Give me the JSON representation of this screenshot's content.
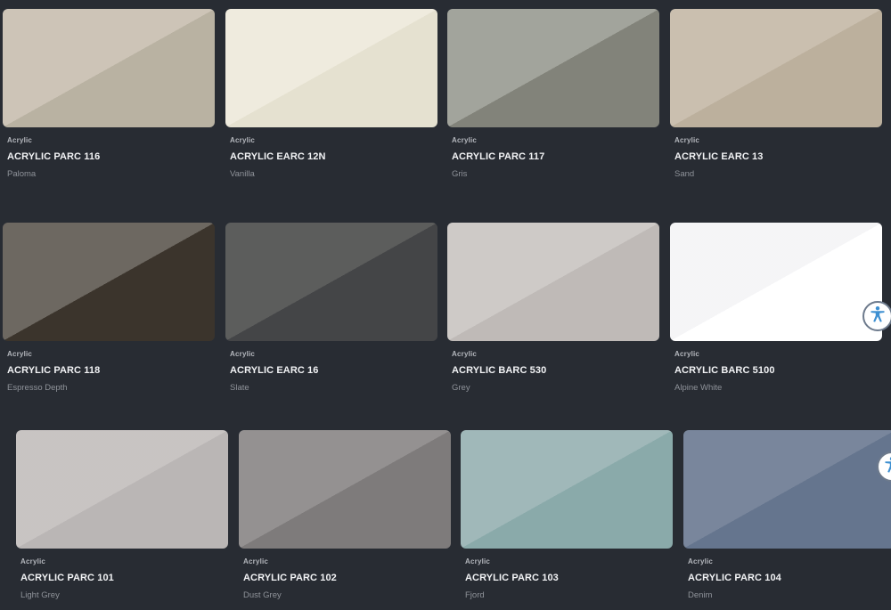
{
  "rows": [
    [
      {
        "category": "Acrylic",
        "title": "ACRYLIC PARC 116",
        "subtitle": "Paloma",
        "colors": [
          "#c9c0b2",
          "#b9b2a2"
        ]
      },
      {
        "category": "Acrylic",
        "title": "ACRYLIC EARC 12N",
        "subtitle": "Vanilla",
        "colors": [
          "#eeeadb",
          "#e5e1d0"
        ]
      },
      {
        "category": "Acrylic",
        "title": "ACRYLIC PARC 117",
        "subtitle": "Gris",
        "colors": [
          "#9b9d94",
          "#82837a"
        ]
      },
      {
        "category": "Acrylic",
        "title": "ACRYLIC EARC 13",
        "subtitle": "Sand",
        "colors": [
          "#c6baa9",
          "#bcb09d"
        ]
      }
    ],
    [
      {
        "category": "Acrylic",
        "title": "ACRYLIC PARC 118",
        "subtitle": "Espresso Depth",
        "colors": [
          "#625c55",
          "#3b342c"
        ]
      },
      {
        "category": "Acrylic",
        "title": "ACRYLIC EARC 16",
        "subtitle": "Slate",
        "colors": [
          "#505150",
          "#444547"
        ]
      },
      {
        "category": "Acrylic",
        "title": "ACRYLIC BARC 530",
        "subtitle": "Grey",
        "colors": [
          "#cac6c3",
          "#bfbab7"
        ]
      },
      {
        "category": "Acrylic",
        "title": "ACRYLIC BARC 5100",
        "subtitle": "Alpine White",
        "colors": [
          "#f4f4f6",
          "#ffffff"
        ]
      }
    ],
    [
      {
        "category": "Acrylic",
        "title": "ACRYLIC PARC 101",
        "subtitle": "Light Grey",
        "colors": [
          "#c4bfbe",
          "#bab6b5"
        ]
      },
      {
        "category": "Acrylic",
        "title": "ACRYLIC PARC 102",
        "subtitle": "Dust Grey",
        "colors": [
          "#8c8989",
          "#7e7b7b"
        ]
      },
      {
        "category": "Acrylic",
        "title": "ACRYLIC PARC 103",
        "subtitle": "Fjord",
        "colors": [
          "#99b3b4",
          "#8aaaaa"
        ]
      },
      {
        "category": "Acrylic",
        "title": "ACRYLIC PARC 104",
        "subtitle": "Denim",
        "colors": [
          "#6f7d94",
          "#65758e"
        ]
      }
    ]
  ],
  "widgets": {
    "accessibility_icon": "accessibility-icon",
    "accessibility_color": "#3d8fd1"
  }
}
